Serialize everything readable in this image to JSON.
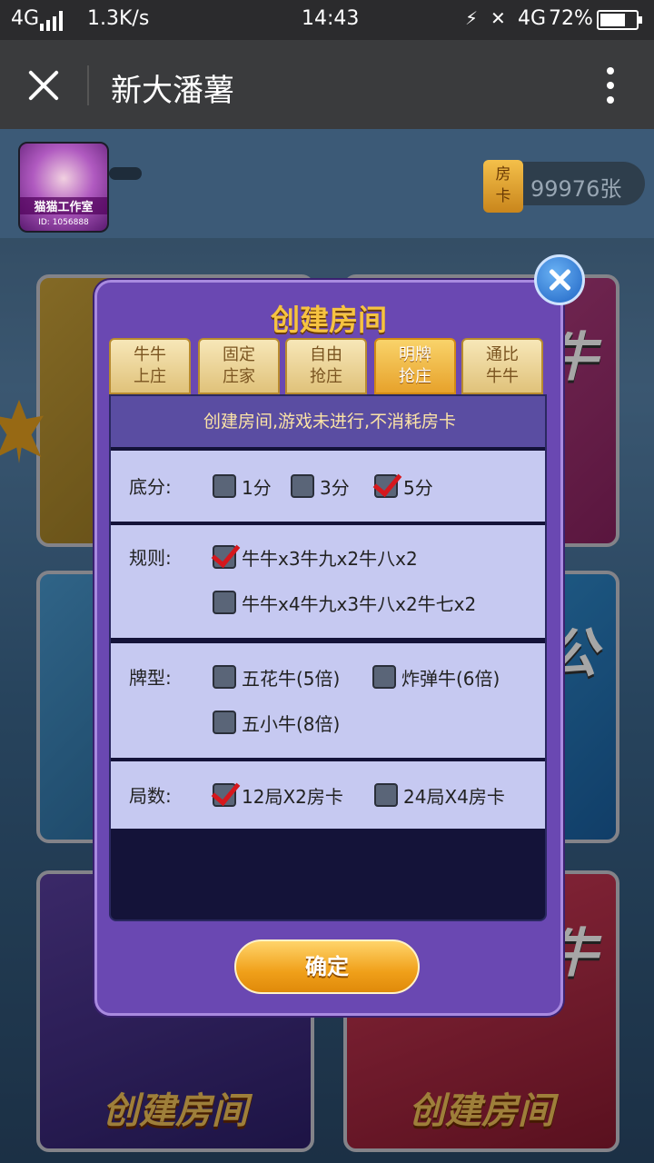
{
  "status_bar": {
    "network": "4G",
    "speed": "1.3K/s",
    "time": "14:43",
    "network_right": "4G",
    "battery_percent": "72%",
    "battery_level": 0.72
  },
  "title_bar": {
    "title": "新大潘薯"
  },
  "user": {
    "avatar_tag": "猫猫工作室",
    "avatar_id": "ID: 1056888",
    "card_label": "房卡",
    "card_count": "99976张"
  },
  "background": {
    "tile_caption_left": "创建房间",
    "tile_caption_right": "创建房间",
    "tile_glyph_top": "牛",
    "tile_glyph_mid": "公",
    "tile_glyph_bottom": "牛"
  },
  "dialog": {
    "title": "创建房间",
    "tabs": [
      {
        "line1": "牛牛",
        "line2": "上庄",
        "active": false
      },
      {
        "line1": "固定",
        "line2": "庄家",
        "active": false
      },
      {
        "line1": "自由",
        "line2": "抢庄",
        "active": false
      },
      {
        "line1": "明牌",
        "line2": "抢庄",
        "active": true
      },
      {
        "line1": "通比",
        "line2": "牛牛",
        "active": false
      }
    ],
    "notice": "创建房间,游戏未进行,不消耗房卡",
    "base_score": {
      "label": "底分:",
      "options": [
        {
          "text": "1分",
          "checked": false
        },
        {
          "text": "3分",
          "checked": false
        },
        {
          "text": "5分",
          "checked": true
        }
      ]
    },
    "rules": {
      "label": "规则:",
      "options": [
        {
          "text": "牛牛x3牛九x2牛八x2",
          "checked": true
        },
        {
          "text": "牛牛x4牛九x3牛八x2牛七x2",
          "checked": false
        }
      ]
    },
    "card_types": {
      "label": "牌型:",
      "options": [
        {
          "text": "五花牛(5倍)",
          "checked": false
        },
        {
          "text": "炸弹牛(6倍)",
          "checked": false
        },
        {
          "text": "五小牛(8倍)",
          "checked": false
        }
      ]
    },
    "rounds": {
      "label": "局数:",
      "options": [
        {
          "text": "12局X2房卡",
          "checked": true
        },
        {
          "text": "24局X4房卡",
          "checked": false
        }
      ]
    },
    "confirm_label": "确定"
  },
  "colors": {
    "dialog_bg": "#6a48b2",
    "title_gold": "#f6c341",
    "check_red": "#d6171d",
    "option_bg": "#c6c9f1"
  }
}
